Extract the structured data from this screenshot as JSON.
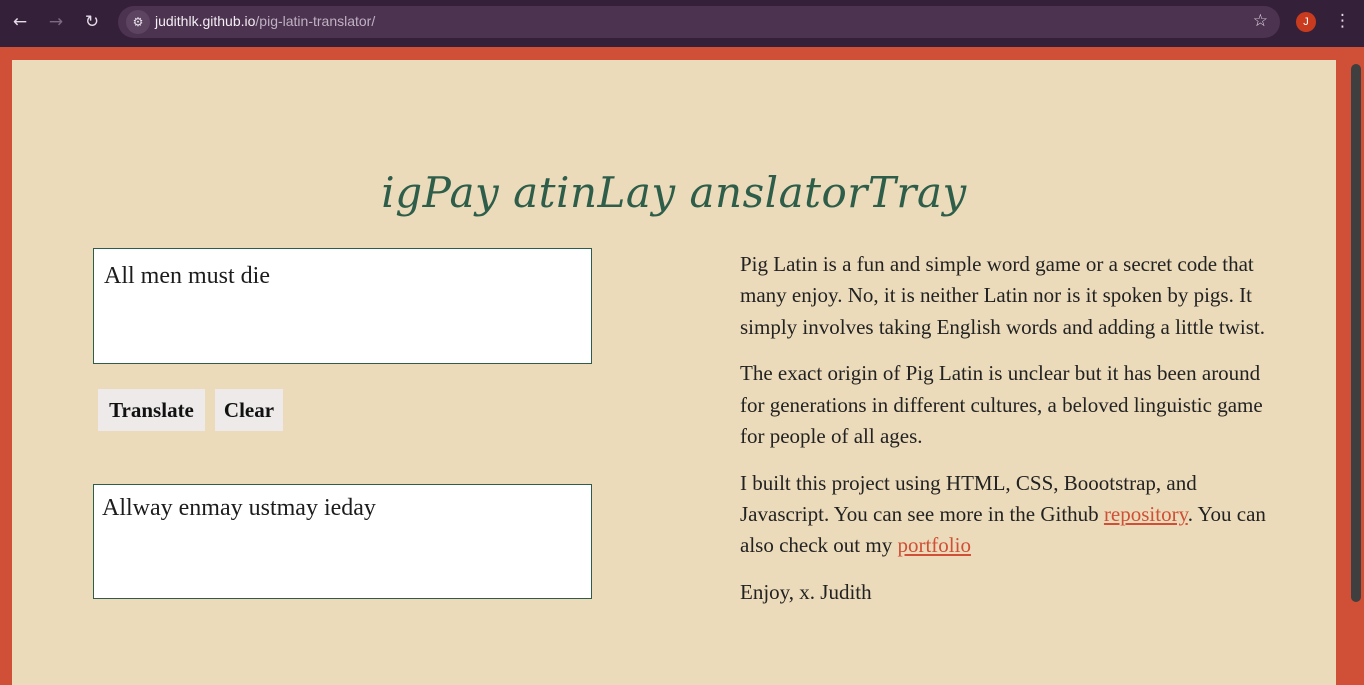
{
  "browser": {
    "url_host": "judithlk.github.io",
    "url_path": "/pig-latin-translator/",
    "profile_initial": "J",
    "icons": {
      "back": "arrow-left",
      "forward": "arrow-right",
      "reload": "reload",
      "site_info": "tune",
      "bookmark": "star-outline",
      "menu": "vertical-dots"
    }
  },
  "colors": {
    "accent": "#cf4f37",
    "title": "#2e5e4a",
    "page_bg": "#ebdbba"
  },
  "page": {
    "title": "igPay atinLay anslatorTray",
    "input_value": "All men must die",
    "translate_label": "Translate",
    "clear_label": "Clear",
    "output_value": "Allway enmay ustmay ieday",
    "about": {
      "p1": "Pig Latin is a fun and simple word game or a secret code that many enjoy. No, it is neither Latin nor is it spoken by pigs. It simply involves taking English words and adding a little twist.",
      "p2": "The exact origin of Pig Latin is unclear but it has been around for generations in different cultures, a beloved linguistic game for people of all ages.",
      "p3_before": "I built this project using HTML, CSS, Boootstrap, and Javascript. You can see more in the Github ",
      "p3_link1": "repository",
      "p3_middle": ". You can also check out my ",
      "p3_link2": "portfolio",
      "p4": "Enjoy, x. Judith"
    }
  }
}
